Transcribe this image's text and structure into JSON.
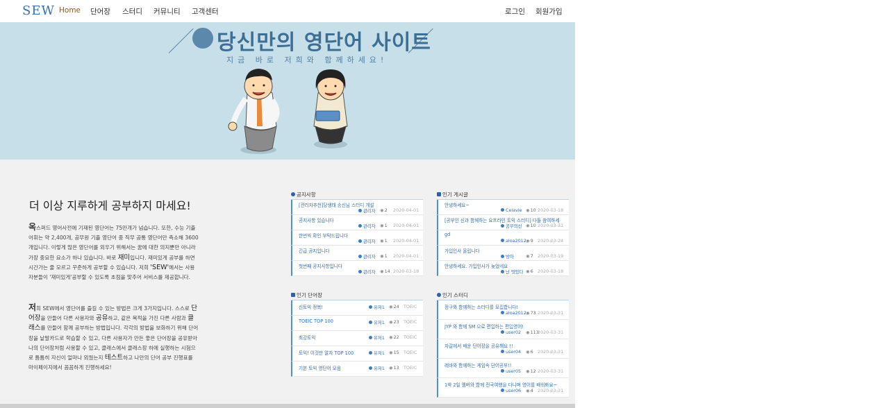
{
  "nav": {
    "logo": "SEW",
    "items": [
      "Home",
      "단어장",
      "스터디",
      "커뮤니티",
      "고객센터"
    ],
    "login": "로그인",
    "signup": "회원가입"
  },
  "hero": {
    "title": "당신만의 영단어 사이트",
    "subtitle": "지금 바로 저희와 함께하세요!"
  },
  "intro": {
    "heading": "더 이상 지루하게 공부하지 마세요!",
    "p1": [
      {
        "t": "옥",
        "c": "big"
      },
      {
        "t": "스퍼드 영어사전에 기재된 영단어는 75만개가 넘습니다. 또한, 수능 기출 어휘는 약 2,400개, 공무원 기출 영단어 중 직무 공통 영단어만 측소해 3600개입니다. 이렇게 많은 영단어를 외우기 위해서는 꿈에 대한 의지뿐만 아니라 가장 중요한 요소가 하나 있습니다. 바로 "
      },
      {
        "t": "재미",
        "c": "hl"
      },
      {
        "t": "입니다. 재미있게 공부를 하면 시간가는 줄 모르고 꾸준하게 공부할 수 있습니다. 저희 "
      },
      {
        "t": "'SEW'",
        "c": "hl"
      },
      {
        "t": "에서는 사용자분들이 '재미있게'공부할 수 있도록 초점을 맞추어 서비스를 제공합니다."
      }
    ],
    "p2": [
      {
        "t": "저",
        "c": "big"
      },
      {
        "t": "희 SEW에서 영단어를 즐길 수 있는 방법은 크게 3가지입니다. 스스로 "
      },
      {
        "t": "단어장",
        "c": "hl"
      },
      {
        "t": "을 만들어 다른 사용자와 "
      },
      {
        "t": "공유",
        "c": "hl"
      },
      {
        "t": "하고, 같은 목적을 가진 다른 사람과 "
      },
      {
        "t": "클래스",
        "c": "hl"
      },
      {
        "t": "를 만들어 함께 공부하는 방법입니다. 각각의 방법을 보화하기 위해 단어장을 낱말카드로 학습할 수 있고, 다른 사용자가 만든 좋은 단어장을 공유받아 나의 단어장처럼 사용할 수 있고, 클래스에서 클래스장 하에 실행하는 시험으로 틈틈히 자신이 얼마나 외웠는지 "
      },
      {
        "t": "테스트",
        "c": "hl"
      },
      {
        "t": "하고 나만의 단어 공부 진행표를 마이페이지에서 꼼꼼하게 진행하세요!"
      }
    ]
  },
  "boards": {
    "notice": {
      "title": "공지사항",
      "rows": [
        {
          "title": "[관리자추천]당생태 송신님 스터디 개설",
          "author": "관리자",
          "views": "2",
          "date": "2020-04-01"
        },
        {
          "title": "공지사항 있습니다",
          "author": "관리자",
          "views": "1",
          "date": "2020-04-01"
        },
        {
          "title": "한번씩 확인 부탁드립니다",
          "author": "관리자",
          "views": "1",
          "date": "2020-04-01"
        },
        {
          "title": "긴급 공지입니다",
          "author": "관리자",
          "views": "1",
          "date": "2020-04-01"
        },
        {
          "title": "첫번째 공지사항입니다",
          "author": "관리자",
          "views": "14",
          "date": "2020-03-18"
        }
      ]
    },
    "popular_posts": {
      "title": "인기 게시글",
      "rows": [
        {
          "title": "안녕하세요~",
          "author": "Celavie",
          "views": "10",
          "date": "2020-03-18"
        },
        {
          "title": "[공부인 신과 함께하는 요프라인 토익 스터디] 다들 참여하세요~",
          "author": "공부의신",
          "views": "10",
          "date": "2020-03-31"
        },
        {
          "title": "gd",
          "author": "aloa2012",
          "views": "9",
          "date": "2020-03-24"
        },
        {
          "title": "가입인사 올립니다",
          "author": "방아",
          "views": "7",
          "date": "2020-03-19"
        },
        {
          "title": "안녕하세요. 가입인사가 늦었네요",
          "author": "난 멋있다",
          "views": "6",
          "date": "2020-03-18"
        }
      ]
    },
    "popular_wordbooks": {
      "title": "인기 단어장",
      "rows": [
        {
          "title": "신토익 정복!",
          "author": "유저1",
          "views": "24",
          "tag": "TOEIC"
        },
        {
          "title": "TOEIC TOP 100",
          "author": "유저1",
          "views": "23",
          "tag": "TOEIC"
        },
        {
          "title": "최강토익",
          "author": "유저1",
          "views": "22",
          "tag": "TOEIC"
        },
        {
          "title": "토익! 이것만 알자 TOP 100",
          "author": "유저1",
          "views": "15",
          "tag": "TOEIC"
        },
        {
          "title": "기본 토익 영단어 모음",
          "author": "유저1",
          "views": "13",
          "tag": "TOEIC"
        }
      ]
    },
    "popular_study": {
      "title": "인기 스터디",
      "rows": [
        {
          "title": "정구와 함께하는 스터디를 모집합니다!",
          "author": "aloa2012",
          "views": "73",
          "date": "2020-03-31"
        },
        {
          "title": "JYP 와 함께 SM 으로 편입하는 편입영어!",
          "author": "user02",
          "views": "113",
          "date": "2020-03-31"
        },
        {
          "title": "자갈에서 배운 단어장을 공유해요 !!",
          "author": "user04",
          "views": "6",
          "date": "2020-03-31"
        },
        {
          "title": "레바와 함께하는 게임속 단어공부!!",
          "author": "user05",
          "views": "12",
          "date": "2020-03-31"
        },
        {
          "title": "1박 2일 멤버와 함께 전국여행을 다니며 영어를 배워봐요~",
          "author": "user06",
          "views": "4",
          "date": "2020-03-31"
        }
      ]
    }
  }
}
